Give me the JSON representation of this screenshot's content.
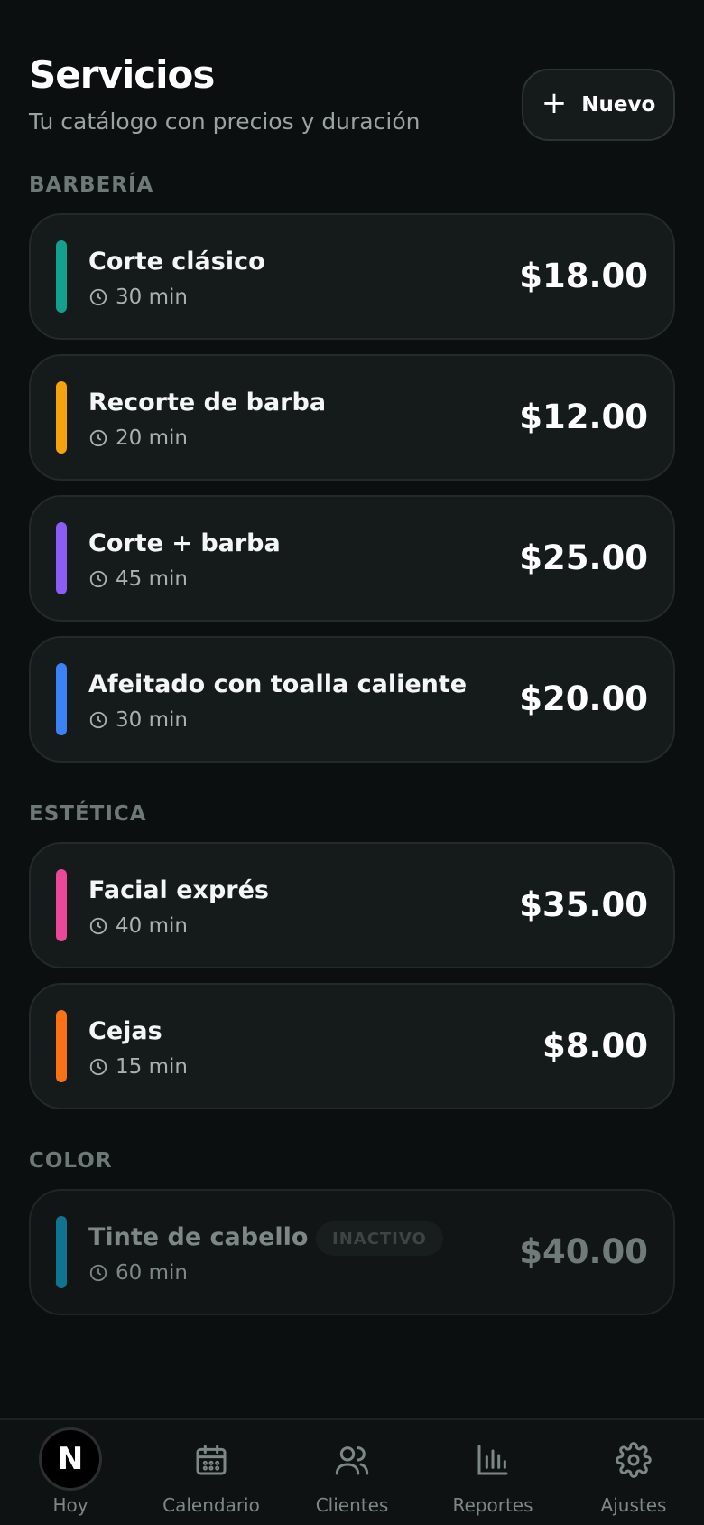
{
  "header": {
    "title": "Servicios",
    "subtitle": "Tu catálogo con precios y duración",
    "new_button_label": "Nuevo"
  },
  "sections": [
    {
      "label": "BARBERÍA",
      "services": [
        {
          "name": "Corte clásico",
          "duration": "30 min",
          "price": "$18.00",
          "color": "#14a08f"
        },
        {
          "name": "Recorte de barba",
          "duration": "20 min",
          "price": "$12.00",
          "color": "#f5a20f"
        },
        {
          "name": "Corte + barba",
          "duration": "45 min",
          "price": "$25.00",
          "color": "#8b5cf6"
        },
        {
          "name": "Afeitado con toalla caliente",
          "duration": "30 min",
          "price": "$20.00",
          "color": "#3b82f6"
        }
      ]
    },
    {
      "label": "ESTÉTICA",
      "services": [
        {
          "name": "Facial exprés",
          "duration": "40 min",
          "price": "$35.00",
          "color": "#ec4899"
        },
        {
          "name": "Cejas",
          "duration": "15 min",
          "price": "$8.00",
          "color": "#f97316"
        }
      ]
    },
    {
      "label": "COLOR",
      "services": [
        {
          "name": "Tinte de cabello",
          "duration": "60 min",
          "price": "$40.00",
          "color": "#0e7490",
          "badge": "INACTIVO"
        }
      ]
    }
  ],
  "tabbar": {
    "home_badge": "N",
    "tabs": [
      {
        "label": "Hoy",
        "icon": "home-icon"
      },
      {
        "label": "Calendario",
        "icon": "calendar-icon"
      },
      {
        "label": "Clientes",
        "icon": "users-icon"
      },
      {
        "label": "Reportes",
        "icon": "bar-chart-icon"
      },
      {
        "label": "Ajustes",
        "icon": "gear-icon"
      }
    ]
  }
}
